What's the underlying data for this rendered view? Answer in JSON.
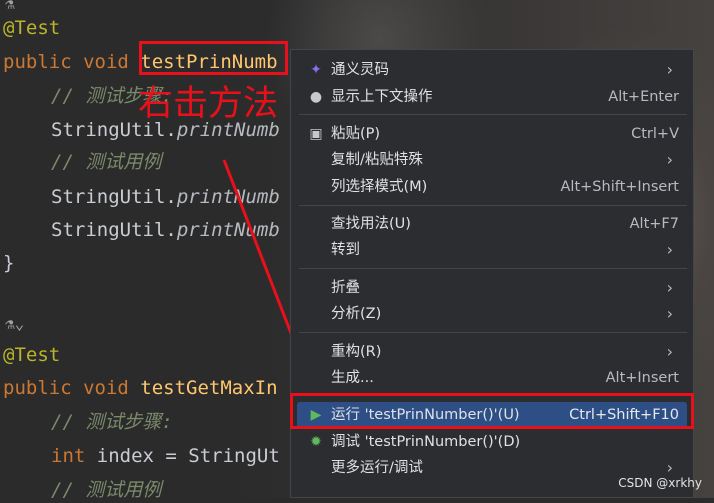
{
  "editor": {
    "lines": [
      {
        "ann": "@Test"
      },
      {
        "kw": "public void ",
        "fn": "testPrinNumb"
      },
      {
        "cm": "// 测试步骤:"
      },
      {
        "plain": "StringUtil.",
        "it": "printNumb"
      },
      {
        "cm": "// 测试用例"
      },
      {
        "plain": "StringUtil.",
        "it": "printNumb"
      },
      {
        "plain": "StringUtil.",
        "it": "printNumb"
      },
      {
        "plain": "}"
      },
      {
        "ann": "@Test"
      },
      {
        "kw": "public void ",
        "fn": "testGetMaxIn"
      },
      {
        "cm": "// 测试步骤:"
      },
      {
        "kw": "int ",
        "plain": "index = StringUt"
      },
      {
        "cm": "// 测试用例"
      }
    ]
  },
  "annotation": {
    "label": "右击方法"
  },
  "menu": {
    "items": [
      {
        "icon": "ai-assistant-icon",
        "label": "通义灵码",
        "submenu": true
      },
      {
        "icon": "bulb-icon",
        "label": "显示上下文操作",
        "shortcut": "Alt+Enter"
      },
      {
        "icon": "clipboard-icon",
        "label": "粘贴(P)",
        "shortcut": "Ctrl+V"
      },
      {
        "label": "复制/粘贴特殊",
        "submenu": true
      },
      {
        "label": "列选择模式(M)",
        "shortcut": "Alt+Shift+Insert"
      },
      {
        "label": "查找用法(U)",
        "shortcut": "Alt+F7"
      },
      {
        "label": "转到",
        "submenu": true
      },
      {
        "label": "折叠",
        "submenu": true
      },
      {
        "label": "分析(Z)",
        "submenu": true
      },
      {
        "label": "重构(R)",
        "submenu": true
      },
      {
        "label": "生成...",
        "shortcut": "Alt+Insert"
      },
      {
        "icon": "run-icon",
        "label": "运行 'testPrinNumber()'(U)",
        "shortcut": "Ctrl+Shift+F10",
        "selected": true
      },
      {
        "icon": "debug-icon",
        "label": "调试 'testPrinNumber()'(D)"
      },
      {
        "label": "更多运行/调试",
        "submenu": true
      }
    ]
  },
  "watermark": "CSDN @xrkhy",
  "colors": {
    "highlight_box": "#e8101a",
    "selection": "#2e4f86"
  }
}
